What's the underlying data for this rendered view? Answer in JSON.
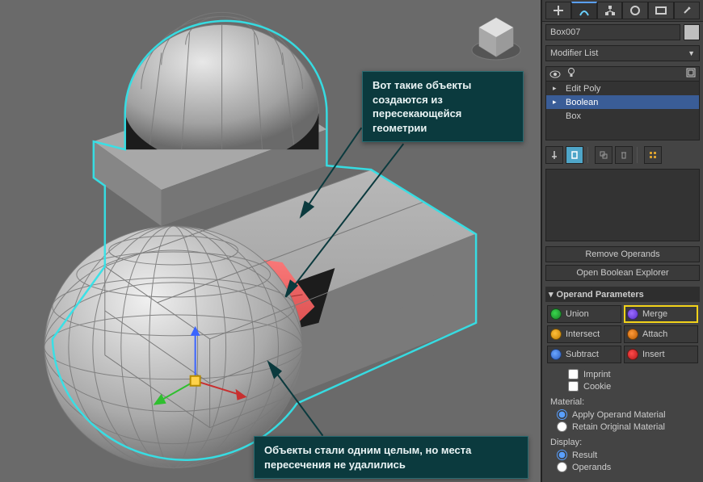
{
  "object_name": "Box007",
  "modifier_list_label": "Modifier List",
  "stack": {
    "items": [
      {
        "expandable": true,
        "label": "Edit Poly",
        "selected": false
      },
      {
        "expandable": true,
        "label": "Boolean",
        "selected": true
      },
      {
        "expandable": false,
        "label": "Box",
        "selected": false
      }
    ]
  },
  "buttons": {
    "remove_operands": "Remove Operands",
    "open_boolean_explorer": "Open Boolean Explorer"
  },
  "rollout_title": "Operand Parameters",
  "operations": {
    "union": "Union",
    "merge": "Merge",
    "intersect": "Intersect",
    "attach": "Attach",
    "subtract": "Subtract",
    "insert": "Insert",
    "selected": "merge"
  },
  "chk": {
    "imprint": "Imprint",
    "cookie": "Cookie"
  },
  "material": {
    "label": "Material:",
    "apply": "Apply Operand Material",
    "retain": "Retain Original Material"
  },
  "display": {
    "label": "Display:",
    "result": "Result",
    "operands": "Operands"
  },
  "callouts": {
    "c1": "Вот такие объекты создаются из пересекающейся геометрии",
    "c2": "Объекты стали одним целым, но места пересечения не удалились"
  }
}
